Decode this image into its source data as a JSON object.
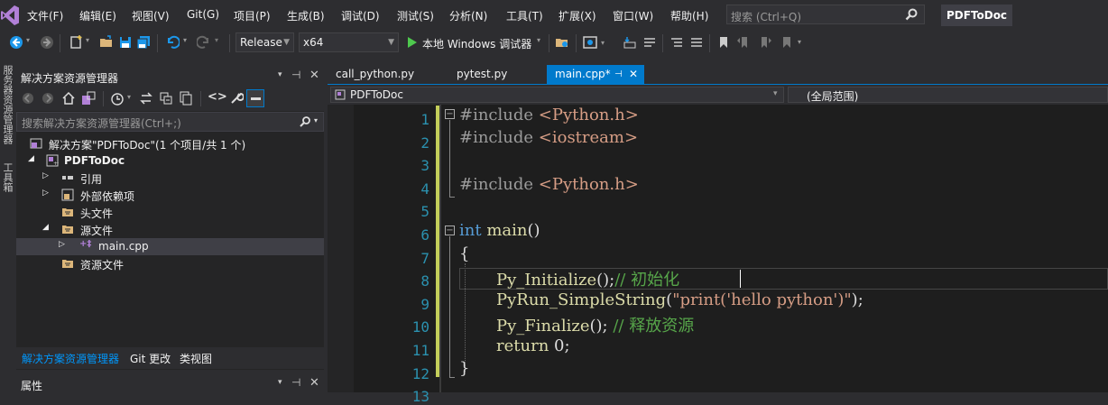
{
  "menubar": {
    "items": [
      "文件(F)",
      "编辑(E)",
      "视图(V)",
      "Git(G)",
      "项目(P)",
      "生成(B)",
      "调试(D)",
      "测试(S)",
      "分析(N)",
      "工具(T)",
      "扩展(X)",
      "窗口(W)",
      "帮助(H)"
    ],
    "search_placeholder": "搜索 (Ctrl+Q)",
    "project_name": "PDFToDoc"
  },
  "toolbar": {
    "config": "Release",
    "platform": "x64",
    "run_label": "本地 Windows 调试器"
  },
  "left_vertical_tabs": [
    "服务器资源管理器",
    "工具箱"
  ],
  "solution_explorer": {
    "title": "解决方案资源管理器",
    "search_placeholder": "搜索解决方案资源管理器(Ctrl+;)",
    "tree": [
      {
        "label": "解决方案\"PDFToDoc\"(1 个项目/共 1 个)"
      },
      {
        "label": "PDFToDoc"
      },
      {
        "label": "引用"
      },
      {
        "label": "外部依赖项"
      },
      {
        "label": "头文件"
      },
      {
        "label": "源文件"
      },
      {
        "label": "main.cpp"
      },
      {
        "label": "资源文件"
      }
    ],
    "bottom_tabs": [
      "解决方案资源管理器",
      "Git 更改",
      "类视图"
    ],
    "properties_title": "属性"
  },
  "editor": {
    "tabs": [
      "call_python.py",
      "pytest.py",
      "main.cpp*"
    ],
    "nav_left": "PDFToDoc",
    "nav_right": "(全局范围)",
    "line_numbers": [
      "1",
      "2",
      "3",
      "4",
      "5",
      "6",
      "7",
      "8",
      "9",
      "10",
      "11",
      "12",
      "13"
    ],
    "code": {
      "l1_a": "#include ",
      "l1_b": "<Python.h>",
      "l2_a": "#include ",
      "l2_b": "<iostream>",
      "l4_a": "#include ",
      "l4_b": "<Python.h>",
      "l6_a": "int",
      "l6_b": " main",
      "l6_c": "()",
      "l7": "{",
      "l8_a": "Py_Initialize",
      "l8_b": "();",
      "l8_c": "// 初始化",
      "l9_a": "PyRun_SimpleString",
      "l9_b": "(",
      "l9_c": "\"print('hello python')\"",
      "l9_d": ");",
      "l10_a": "Py_Finalize",
      "l10_b": "(); ",
      "l10_c": "// 释放资源",
      "l11_a": "return",
      "l11_b": " 0;",
      "l12": "}"
    }
  }
}
